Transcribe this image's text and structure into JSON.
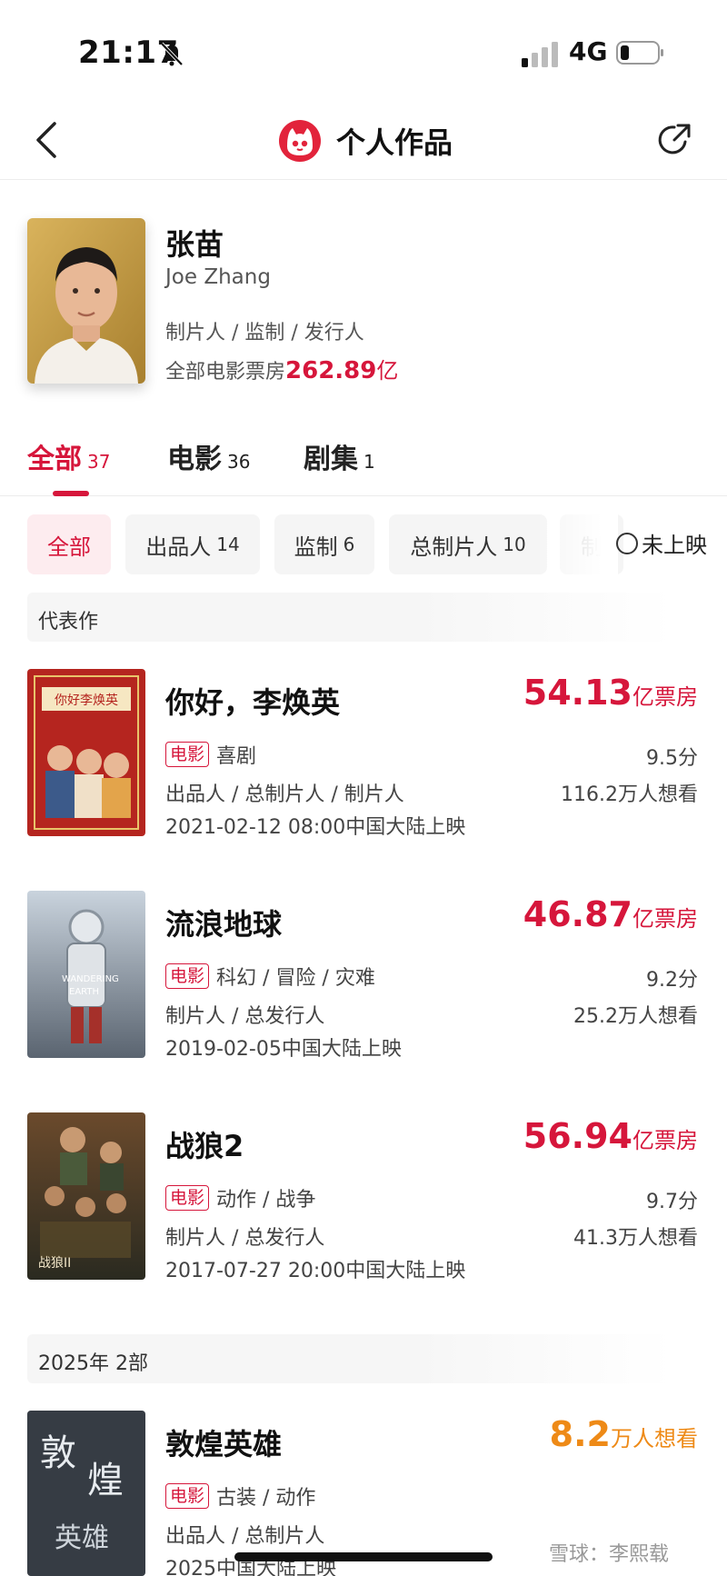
{
  "status_bar": {
    "time": "21:17",
    "network": "4G"
  },
  "nav": {
    "title": "个人作品"
  },
  "profile": {
    "name": "张苗",
    "english_name": "Joe Zhang",
    "roles": "制片人 / 监制 / 发行人",
    "box_office_label": "全部电影票房",
    "box_office_value": "262.89",
    "box_office_unit": "亿"
  },
  "tabs": [
    {
      "label": "全部",
      "count": "37",
      "active": true
    },
    {
      "label": "电影",
      "count": "36",
      "active": false
    },
    {
      "label": "剧集",
      "count": "1",
      "active": false
    }
  ],
  "filters": [
    {
      "label": "全部",
      "count": "",
      "active": true
    },
    {
      "label": "出品人",
      "count": "14",
      "active": false
    },
    {
      "label": "监制",
      "count": "6",
      "active": false
    },
    {
      "label": "总制片人",
      "count": "10",
      "active": false
    },
    {
      "label": "制",
      "count": "",
      "active": false
    }
  ],
  "unreleased_label": "未上映",
  "sections": {
    "representative": "代表作",
    "year_2025": "2025年  2部"
  },
  "movies": [
    {
      "title": "你好，李焕英",
      "stat_value": "54.13",
      "stat_unit": "亿票房",
      "type_badge": "电影",
      "genre": "喜剧",
      "roles": "出品人 / 总制片人 / 制片人",
      "release": "2021-02-12 08:00中国大陆上映",
      "score": "9.5分",
      "want": "116.2万人想看"
    },
    {
      "title": "流浪地球",
      "stat_value": "46.87",
      "stat_unit": "亿票房",
      "type_badge": "电影",
      "genre": "科幻 / 冒险 / 灾难",
      "roles": "制片人 / 总发行人",
      "release": "2019-02-05中国大陆上映",
      "score": "9.2分",
      "want": "25.2万人想看"
    },
    {
      "title": "战狼2",
      "stat_value": "56.94",
      "stat_unit": "亿票房",
      "type_badge": "电影",
      "genre": "动作 / 战争",
      "roles": "制片人 / 总发行人",
      "release": "2017-07-27 20:00中国大陆上映",
      "score": "9.7分",
      "want": "41.3万人想看"
    },
    {
      "title": "敦煌英雄",
      "stat_value": "8.2",
      "stat_unit": "万人想看",
      "type_badge": "电影",
      "genre": "古装 / 动作",
      "roles": "出品人 / 总制片人",
      "release": "2025中国大陆上映",
      "score": "",
      "want": ""
    }
  ],
  "watermark": "雪球：李熙载",
  "colors": {
    "accent": "#d6163b",
    "orange": "#ee8a17"
  }
}
